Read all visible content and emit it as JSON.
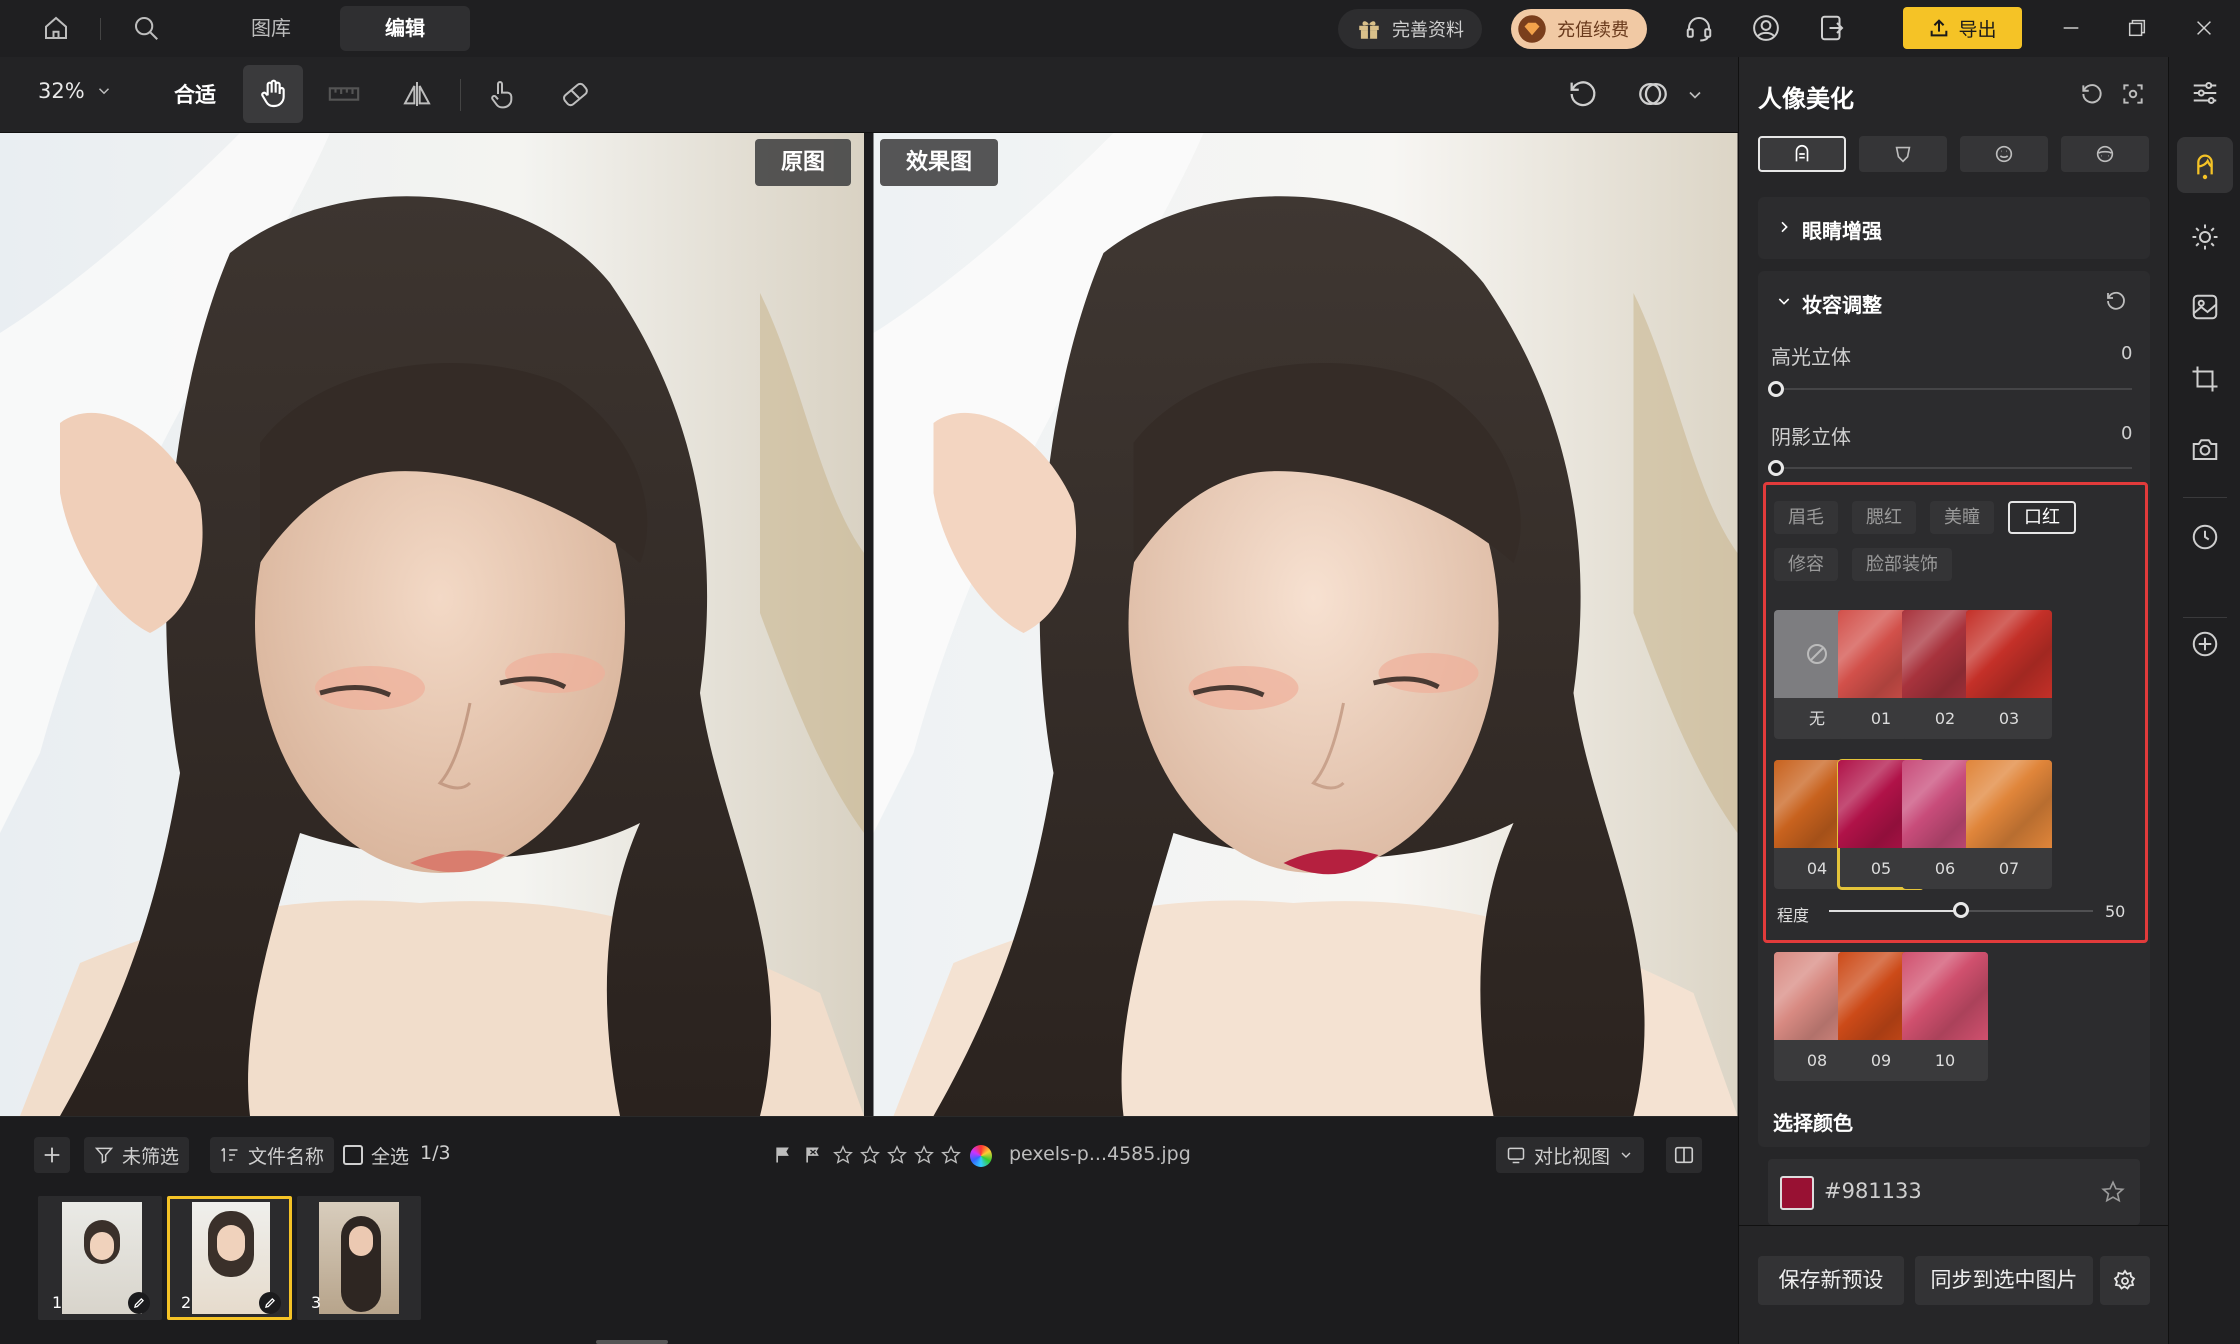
{
  "titlebar": {
    "tabs": [
      {
        "label": "图库"
      },
      {
        "label": "编辑"
      }
    ],
    "profile_label": "完善资料",
    "vip_label": "充值续费",
    "export_label": "导出"
  },
  "toolbar": {
    "zoom": "32%",
    "fit_label": "合适"
  },
  "canvas": {
    "original_label": "原图",
    "effect_label": "效果图"
  },
  "bottom": {
    "filter_label": "未筛选",
    "sort_label": "文件名称",
    "select_all_label": "全选",
    "count": "1/3",
    "filename": "pexels-p...4585.jpg",
    "compare_label": "对比视图",
    "thumbnails": [
      {
        "num": "1"
      },
      {
        "num": "2"
      },
      {
        "num": "3"
      }
    ]
  },
  "panel": {
    "title": "人像美化",
    "eye_section": "眼睛增强",
    "makeup_section": "妆容调整",
    "highlight": {
      "label": "高光立体",
      "value": "0"
    },
    "shadow": {
      "label": "阴影立体",
      "value": "0"
    },
    "chips": [
      "眉毛",
      "腮红",
      "美瞳",
      "口红",
      "修容",
      "脸部装饰"
    ],
    "active_chip": "口红",
    "swatches": [
      {
        "label": "无",
        "color": "#7d7d80"
      },
      {
        "label": "01",
        "color": "#d2504a"
      },
      {
        "label": "02",
        "color": "#a8333d"
      },
      {
        "label": "03",
        "color": "#c43028"
      },
      {
        "label": "04",
        "color": "#c8621e"
      },
      {
        "label": "05",
        "color": "#b01248"
      },
      {
        "label": "06",
        "color": "#c84c7a"
      },
      {
        "label": "07",
        "color": "#e0853a"
      },
      {
        "label": "08",
        "color": "#d88a82"
      },
      {
        "label": "09",
        "color": "#cc4a18"
      },
      {
        "label": "10",
        "color": "#d0506e"
      }
    ],
    "selected_swatch": "05",
    "degree": {
      "label": "程度",
      "value": "50",
      "fraction": 0.5
    },
    "choose_color_label": "选择颜色",
    "color_hex": "#981133",
    "save_preset_label": "保存新预设",
    "sync_label": "同步到选中图片"
  },
  "colors": {
    "accent_yellow": "#f5c326",
    "selection_red": "#e23b3b"
  }
}
